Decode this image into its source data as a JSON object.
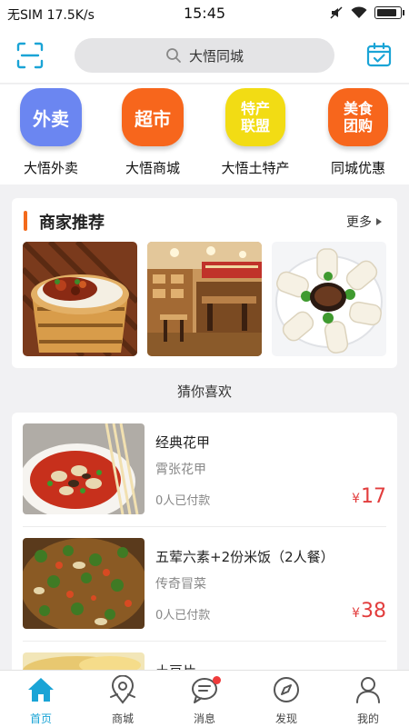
{
  "status_bar": {
    "carrier": "无SIM",
    "speed": "17.5K/s",
    "time": "15:45",
    "battery_level": 0.9
  },
  "header": {
    "search_text": "大悟同城"
  },
  "quick_links": [
    {
      "bubble": "外卖",
      "label": "大悟外卖",
      "color": "#6b86f1"
    },
    {
      "bubble": "超市",
      "label": "大悟商城",
      "color": "#f7661c"
    },
    {
      "bubble": "特产\n联盟",
      "label": "大悟土特产",
      "color": "#f2dc14"
    },
    {
      "bubble": "美食\n团购",
      "label": "同城优惠",
      "color": "#f7661c"
    }
  ],
  "merchant": {
    "title": "商家推荐",
    "more_label": "更多"
  },
  "guess": {
    "title": "猜你喜欢",
    "items": [
      {
        "name": "经典花甲",
        "shop": "霄张花甲",
        "paid": "0人已付款",
        "currency": "¥",
        "price": "17"
      },
      {
        "name": "五荤六素+2份米饭（2人餐）",
        "shop": "传奇冒菜",
        "paid": "0人已付款",
        "currency": "¥",
        "price": "38"
      },
      {
        "name": "土豆片",
        "shop": "",
        "paid": "",
        "currency": "",
        "price": ""
      }
    ]
  },
  "tabs": [
    {
      "label": "首页",
      "icon": "home-icon",
      "active": true
    },
    {
      "label": "商城",
      "icon": "map-pin-icon",
      "active": false
    },
    {
      "label": "消息",
      "icon": "message-icon",
      "active": false
    },
    {
      "label": "发现",
      "icon": "compass-icon",
      "active": false
    },
    {
      "label": "我的",
      "icon": "person-icon",
      "active": false
    }
  ],
  "colors": {
    "accent": "#1aa4d6",
    "price": "#e23d3d",
    "section_bar": "#f36a1c"
  }
}
